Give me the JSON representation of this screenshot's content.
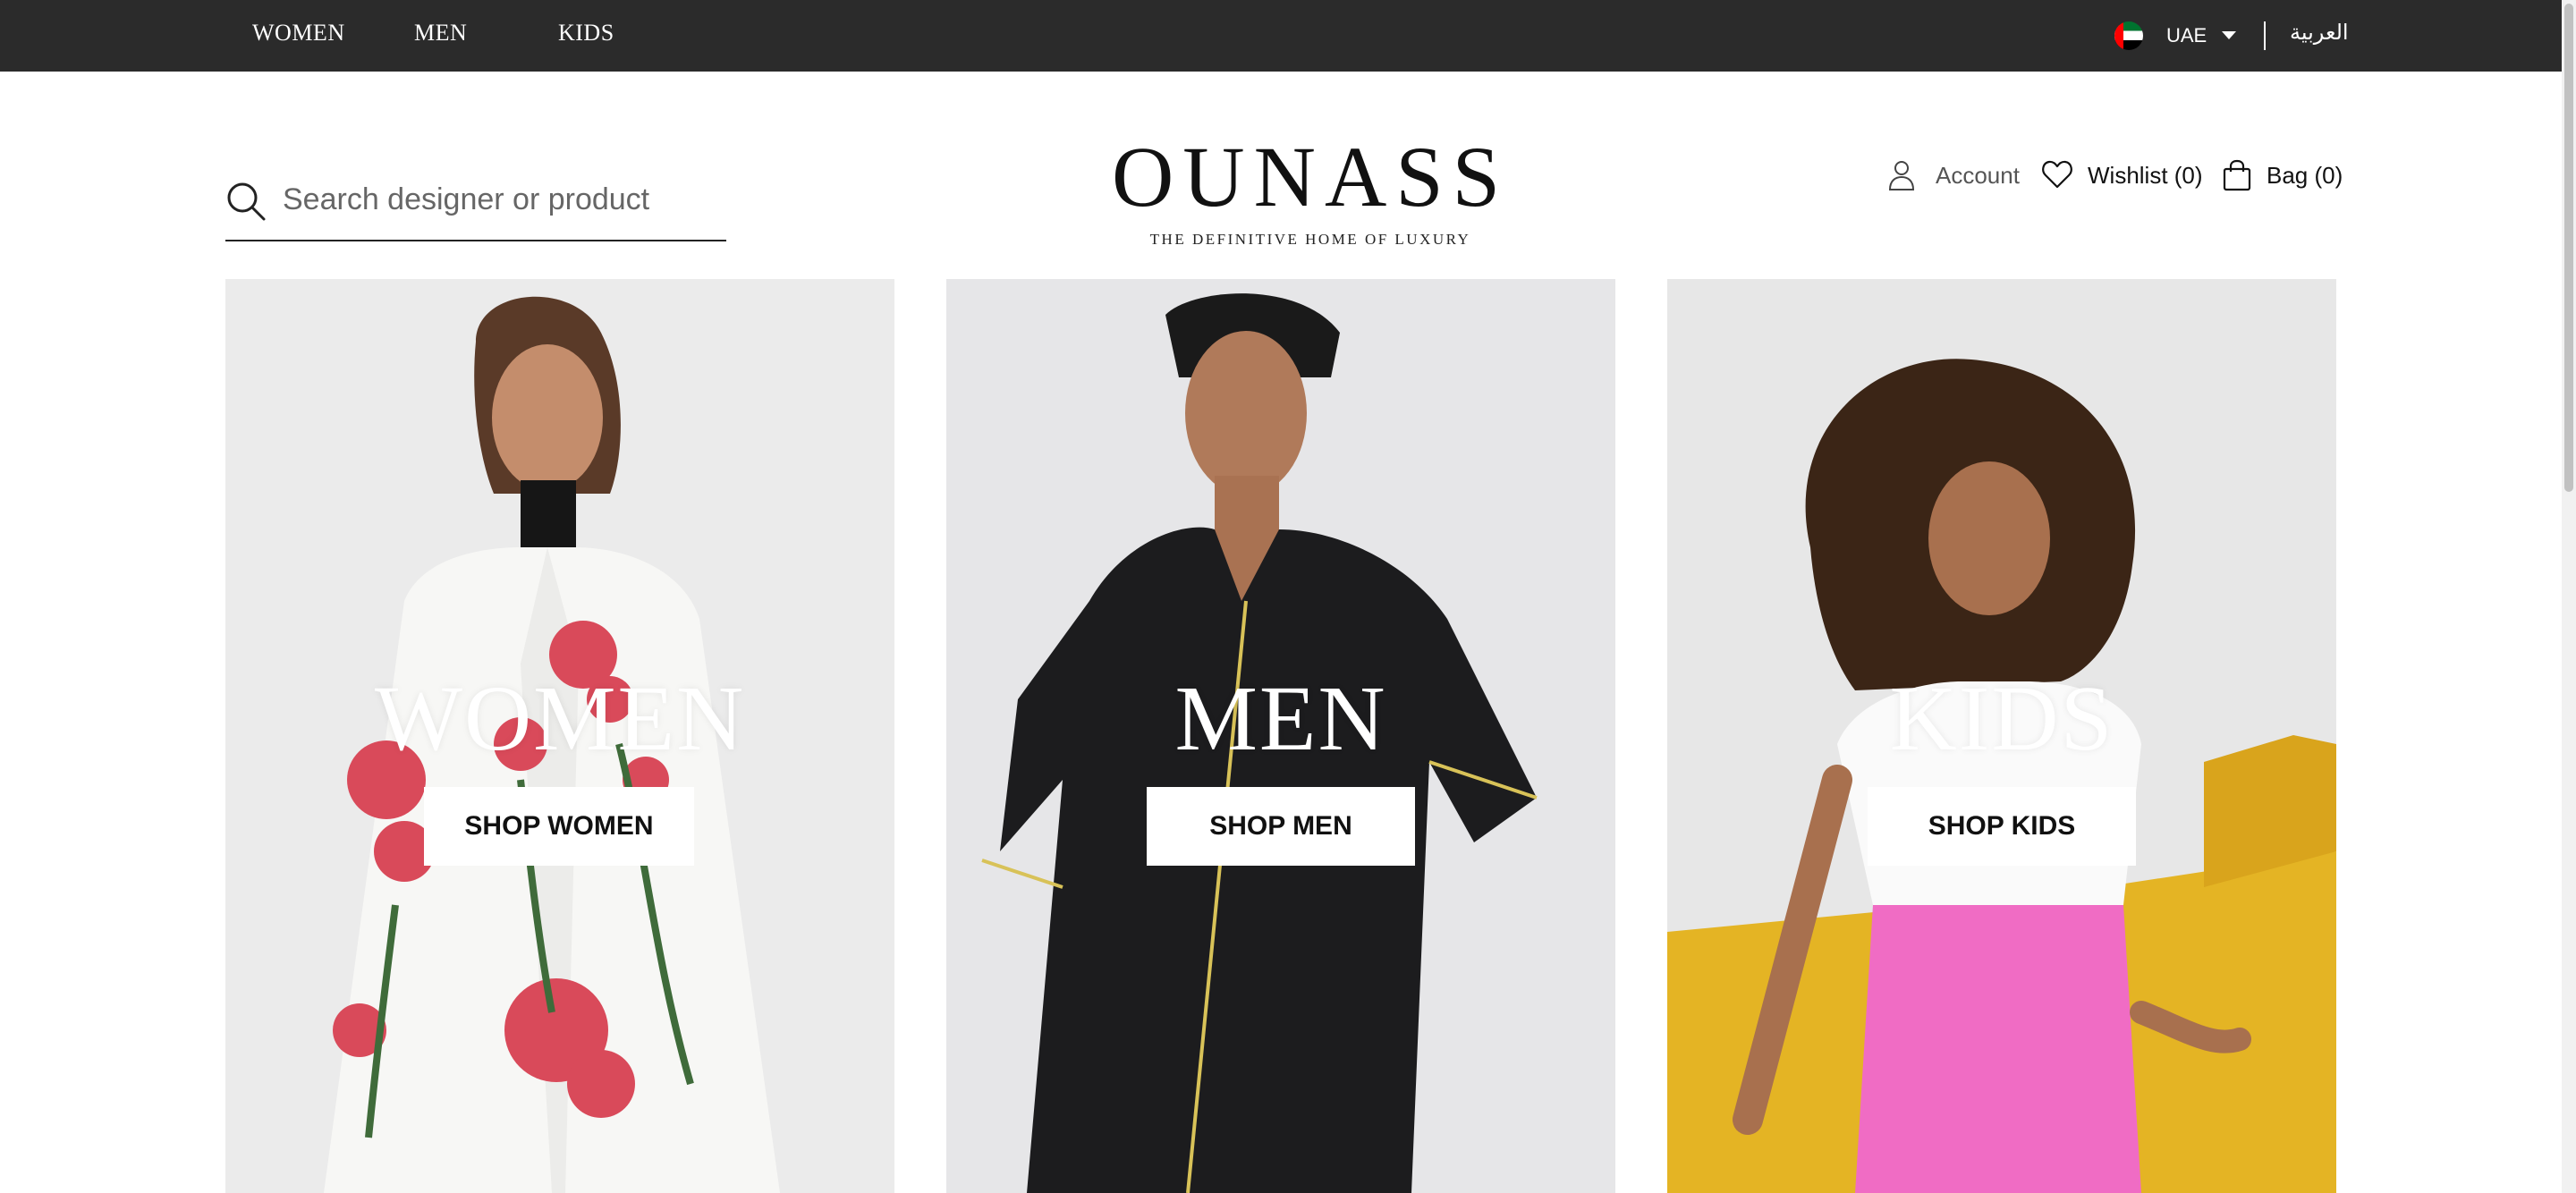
{
  "topbar": {
    "nav": [
      {
        "label": "WOMEN"
      },
      {
        "label": "MEN"
      },
      {
        "label": "KIDS"
      }
    ],
    "country": {
      "code": "UAE",
      "flag_icon": "uae-flag-icon"
    },
    "language_toggle": "العربية",
    "background": "#2b2b2b"
  },
  "header": {
    "search": {
      "placeholder": "Search designer or product",
      "value": ""
    },
    "logo": {
      "wordmark": "OUNASS",
      "tagline": "THE DEFINITIVE HOME OF LUXURY"
    },
    "account": {
      "label": "Account",
      "icon": "user-icon"
    },
    "wishlist": {
      "label": "Wishlist (0)",
      "icon": "heart-icon"
    },
    "bag": {
      "label": "Bag (0)",
      "icon": "shopping-bag-icon"
    }
  },
  "tiles": [
    {
      "title": "WOMEN",
      "button": "SHOP WOMEN"
    },
    {
      "title": "MEN",
      "button": "SHOP MEN"
    },
    {
      "title": "KIDS",
      "button": "SHOP KIDS"
    }
  ]
}
